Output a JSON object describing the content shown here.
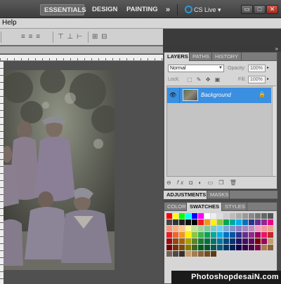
{
  "appbar": {
    "workspaces": [
      "ESSENTIALS",
      "DESIGN",
      "PAINTING"
    ],
    "more_glyph": "»",
    "cs_live_label": "CS Live",
    "cs_live_caret": "▾",
    "window_buttons": [
      "▭",
      "□",
      "✕"
    ]
  },
  "menubar": {
    "help_label": "Help"
  },
  "document": {},
  "panels": {
    "collapse_glyph": "»",
    "layers_tabs": [
      "LAYERS",
      "PATHS",
      "HISTORY"
    ],
    "blend_mode": "Normal",
    "opacity_label": "Opacity:",
    "opacity_value": "100%",
    "lock_label": "Lock:",
    "fill_label": "Fill:",
    "fill_value": "100%",
    "layer_name": "Background",
    "adjust_tabs": [
      "ADJUSTMENTS",
      "MASKS"
    ],
    "swatch_tabs": [
      "COLOR",
      "SWATCHES",
      "STYLES"
    ]
  },
  "watermark": "PhotoshopdesaiN.com",
  "swatch_colors": [
    [
      "#ff0000",
      "#ffff00",
      "#00ff00",
      "#00ffff",
      "#0000ff",
      "#ff00ff",
      "#ffffff",
      "#eeeeee",
      "#dddddd",
      "#cccccc",
      "#bbbbbb",
      "#aaaaaa",
      "#999999",
      "#888888",
      "#777777",
      "#666666",
      "#555555"
    ],
    [
      "#444444",
      "#333333",
      "#222222",
      "#111111",
      "#000000",
      "#ed1c24",
      "#f7941d",
      "#fff200",
      "#8dc63f",
      "#00a651",
      "#00a99d",
      "#00aeef",
      "#0072bc",
      "#2e3192",
      "#662d91",
      "#92278f",
      "#ec008c"
    ],
    [
      "#f69679",
      "#f9ad81",
      "#fdc689",
      "#fff799",
      "#c4df9b",
      "#a3d39c",
      "#82ca9c",
      "#7accc8",
      "#6dcff6",
      "#7da7d9",
      "#8393ca",
      "#8781bd",
      "#a187be",
      "#bd8cbf",
      "#f49ac1",
      "#f5989d",
      "#e9a48b"
    ],
    [
      "#ed1c24",
      "#f26522",
      "#f7941d",
      "#fff200",
      "#8dc63f",
      "#39b54a",
      "#00a651",
      "#00a99d",
      "#00aeef",
      "#0072bc",
      "#0054a6",
      "#2e3192",
      "#662d91",
      "#92278f",
      "#9e005d",
      "#ed145b",
      "#c1272d"
    ],
    [
      "#9e0b0f",
      "#a0410d",
      "#a36209",
      "#aba000",
      "#598527",
      "#1a7b30",
      "#007236",
      "#00746b",
      "#0076a3",
      "#004b80",
      "#003471",
      "#1b1464",
      "#440e62",
      "#630460",
      "#790000",
      "#9e005d",
      "#c69c6d"
    ],
    [
      "#790000",
      "#7b2e00",
      "#7d4900",
      "#827b00",
      "#406618",
      "#005e20",
      "#005826",
      "#005952",
      "#005b7f",
      "#003663",
      "#002157",
      "#0d004c",
      "#32004b",
      "#4b0049",
      "#7b0046",
      "#a67c52",
      "#8c6239"
    ],
    [
      "#736357",
      "#534741",
      "#362f2d",
      "#c69c6d",
      "#a67c52",
      "#8c6239",
      "#754c24",
      "#603913"
    ]
  ]
}
